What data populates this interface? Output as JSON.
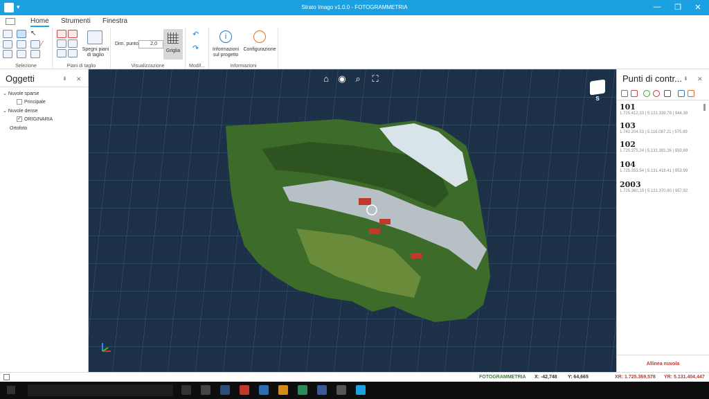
{
  "app": {
    "title": "Strato Imago v1.0.0 - FOTOGRAMMETRIA",
    "quick_access": "▾",
    "minimize": "—",
    "maximize": "❐",
    "close": "✕"
  },
  "tabs": [
    {
      "label": "Home"
    },
    {
      "label": "Strumenti"
    },
    {
      "label": "Finestra"
    }
  ],
  "ribbon": {
    "groups": {
      "selezione": "Selezione",
      "piani": "Piani di taglio",
      "visualizzazione": "Visualizzazione",
      "modifica": "Modif...",
      "informazioni": "Informazioni"
    },
    "spegni_label": "Spegni piani di taglio",
    "dim_punto_label": "Dim. punto",
    "dim_punto_value": "2,0",
    "griglia_label": "Griglia",
    "info_label": "Informazioni sul progetto",
    "config_label": "Configurazione"
  },
  "left_panel": {
    "title": "Oggetti",
    "items": [
      {
        "label": "Nuvole sparse"
      },
      {
        "label": "Principale"
      },
      {
        "label": "Nuvole dense"
      },
      {
        "label": "ORIGINARIA"
      },
      {
        "label": "Ortofoto"
      }
    ]
  },
  "viewport": {
    "compass_letter": "S"
  },
  "right_panel": {
    "title": "Punti di contr...",
    "points": [
      {
        "id": "101",
        "coords": "1.725.412,33 | 5.131.339,78 | 944,38"
      },
      {
        "id": "103",
        "coords": "1.743.204,53 | 5.116.087,21 | 575,89"
      },
      {
        "id": "102",
        "coords": "1.725.375,24 | 5.131.391,26 | 950,89"
      },
      {
        "id": "104",
        "coords": "1.725.353,54 | 5.131.418,41 | 953,99"
      },
      {
        "id": "2003",
        "coords": "1.725.360,19 | 5.131.370,80 | 957,92"
      }
    ],
    "action": "Allinea nuvola"
  },
  "status": {
    "mode": "FOTOGRAMMETRIA",
    "x": "X: -42,748",
    "y": "Y: 64,665",
    "xr": "XR: 1.725.369,578",
    "yr": "YR: 5.131.404,447"
  },
  "colors": {
    "accent": "#1ba1e2",
    "status_mode": "#2e8b2e",
    "status_real": "#c0392b"
  }
}
